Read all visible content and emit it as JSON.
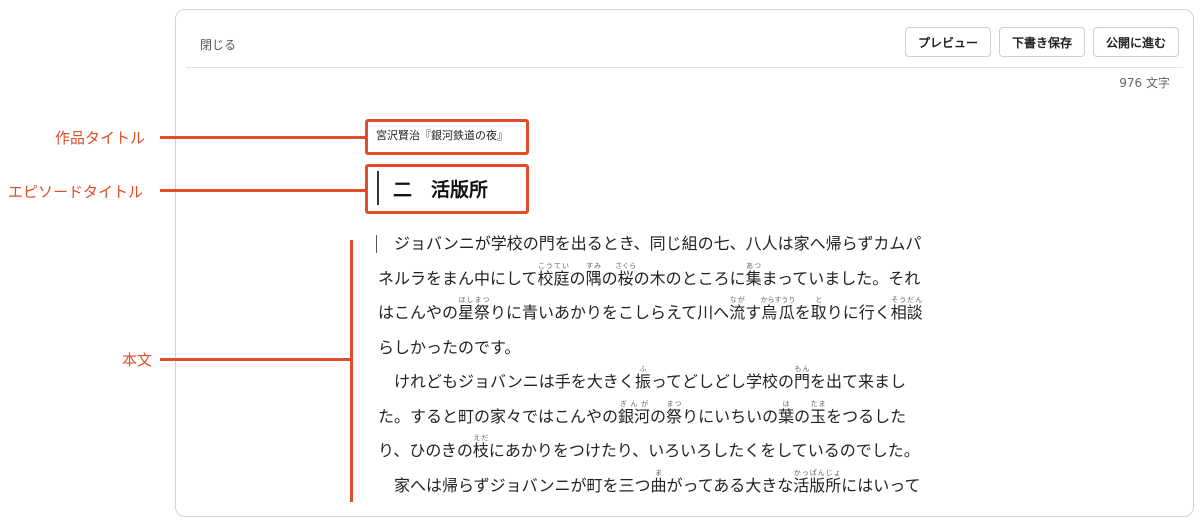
{
  "toolbar": {
    "close_label": "閉じる",
    "preview_label": "プレビュー",
    "draft_label": "下書き保存",
    "publish_label": "公開に進む"
  },
  "editor": {
    "char_count": "976 文字",
    "work_title": "宮沢賢治『銀河鉄道の夜』",
    "episode_title": "二　活版所"
  },
  "annotations": {
    "work_title": "作品タイトル",
    "episode_title": "エピソードタイトル",
    "body": "本文"
  },
  "body": {
    "l1": "ジョバンニが学校の門を出るとき、同じ組の七、八人は家へ帰らずカムパ",
    "l2a": "ネルラをまん中にして",
    "kotei": "校庭",
    "kotei_r": "こうてい",
    "l2b": "の",
    "sumi": "隅",
    "sumi_r": "すみ",
    "l2c": "の",
    "sakura": "桜",
    "sakura_r": "さくら",
    "l2d": "の木のところに",
    "atsu": "集",
    "atsu_r": "あつ",
    "l2e": "まっていました。それ",
    "l3a": "はこんやの",
    "hoshi": "星祭",
    "hoshi_r": "ほしまつ",
    "l3b": "りに青いあかりをこしらえて川へ",
    "naga": "流",
    "naga_r": "なが",
    "l3c": "す",
    "karasu": "烏瓜",
    "karasu_r": "からすうり",
    "l3d": "を",
    "to": "取",
    "to_r": "と",
    "l3e": "りに行く",
    "sodan": "相談",
    "sodan_r": "そうだん",
    "l4": "らしかったのです。",
    "l5a": "けれどもジョバンニは手を大きく",
    "fu": "振",
    "fu_r": "ふ",
    "l5b": "ってどしどし学校の",
    "mon": "門",
    "mon_r": "もん",
    "l5c": "を出て来まし",
    "l6a": "た。すると町の家々ではこんやの",
    "ginga": "銀河",
    "ginga_r": "ぎんが",
    "l6b": "の",
    "matsu": "祭",
    "matsu_r": "まつ",
    "l6c": "りにいちいの",
    "ha": "葉",
    "ha_r": "は",
    "l6d": "の",
    "tama": "玉",
    "tama_r": "たま",
    "l6e": "をつるした",
    "l7a": "り、ひのきの",
    "eda": "枝",
    "eda_r": "えだ",
    "l7b": "にあかりをつけたり、いろいろしたくをしているのでした。",
    "l8a": "家へは帰らずジョバンニが町を三つ",
    "ma": "曲",
    "ma_r": "ま",
    "l8b": "がってある大きな",
    "kappan": "活版所",
    "kappan_r": "かっぱんじょ",
    "l8c": "にはいって"
  }
}
